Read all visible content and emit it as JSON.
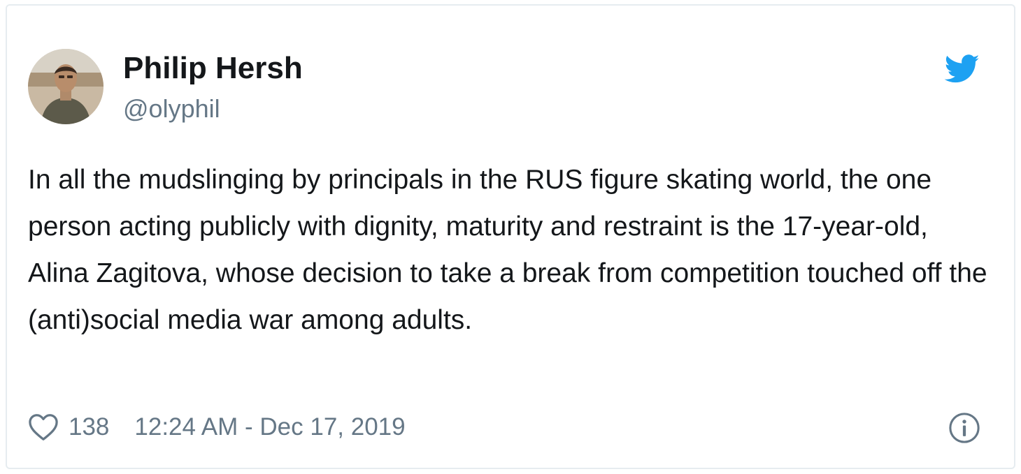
{
  "tweet": {
    "author_name": "Philip Hersh",
    "author_handle": "@olyphil",
    "text": "In all the mudslinging by principals in the RUS figure skating world, the one person acting publicly with dignity, maturity and restraint is the 17-year-old, Alina Zagitova, whose decision to take a break from competition touched off the (anti)social media war among adults.",
    "like_count": "138",
    "timestamp": "12:24 AM - Dec 17, 2019"
  },
  "icons": {
    "brand": "twitter-bird-icon",
    "like": "heart-icon",
    "info": "info-icon"
  },
  "colors": {
    "brand": "#1da1f2",
    "text_primary": "#14171a",
    "text_secondary": "#657786",
    "border": "#e6ecf0"
  }
}
